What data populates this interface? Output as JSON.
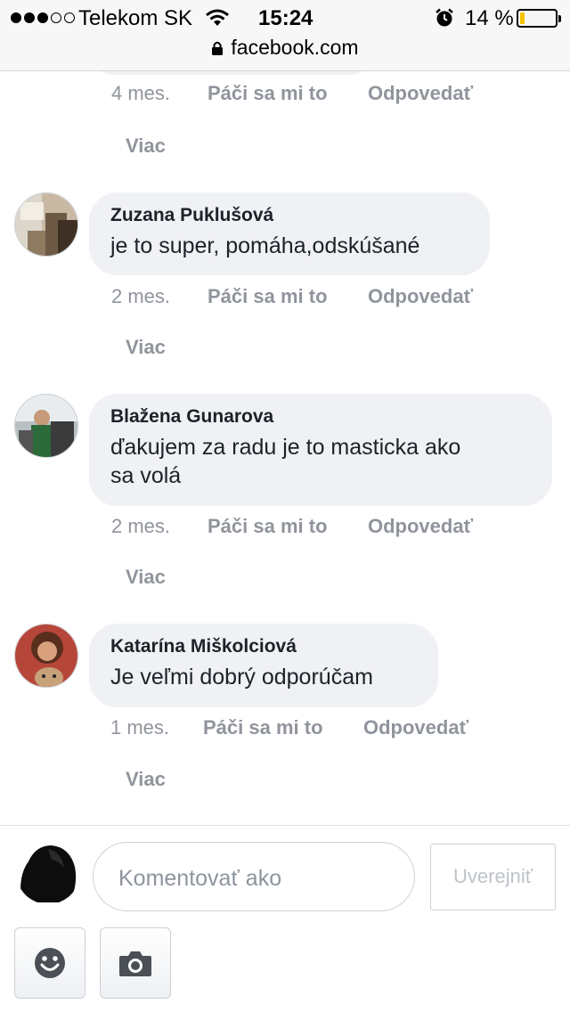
{
  "status_bar": {
    "carrier": "Telekom SK",
    "time": "15:24",
    "battery": "14 %",
    "battery_level": 0.14,
    "signal_bars": 3
  },
  "browser": {
    "url": "facebook.com"
  },
  "previous_comment": {
    "time": "4 mes.",
    "like": "Páči sa mi to",
    "reply": "Odpovedať",
    "more": "Viac"
  },
  "comments": [
    {
      "author": "Zuzana Puklušová",
      "text": "je to super, pomáha,odskúšané",
      "time": "2 mes.",
      "like": "Páči sa mi to",
      "reply": "Odpovedať",
      "more": "Viac"
    },
    {
      "author": "Blažena Gunarova",
      "text_line1": "ďakujem za radu je to masticka ako",
      "text_line2": "sa volá",
      "time": "2 mes.",
      "like": "Páči sa mi to",
      "reply": "Odpovedať",
      "more": "Viac"
    },
    {
      "author": "Katarína Miškolciová",
      "text": "Je veľmi dobrý odporúčam",
      "time": "1 mes.",
      "like": "Páči sa mi to",
      "reply": "Odpovedať",
      "more": "Viac"
    }
  ],
  "composer": {
    "placeholder": "Komentovať ako",
    "post_label": "Uverejniť",
    "emoji_icon": "smiley-icon",
    "camera_icon": "camera-icon"
  },
  "colors": {
    "meta_gray": "#90949c",
    "bubble_bg": "#f0f1f4",
    "battery": "#f5c400"
  }
}
